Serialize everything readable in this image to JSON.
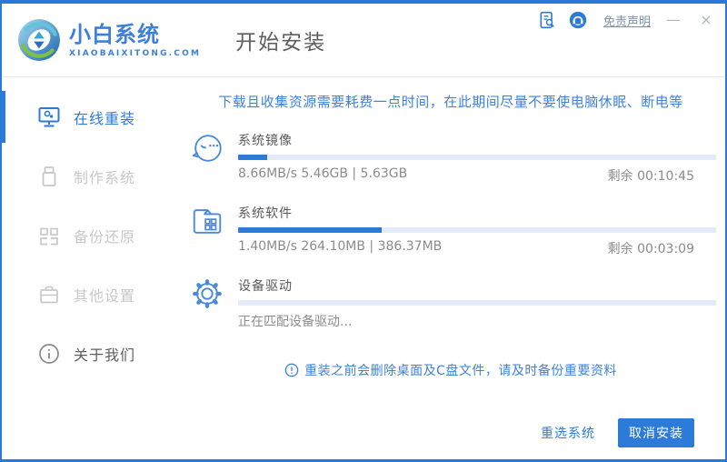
{
  "colors": {
    "accent": "#2d7bd8",
    "notice_blue": "#3e82dc",
    "track": "#e2ebf7",
    "inactive_gray": "#c8c8c8",
    "text_gray": "#5a5a5a",
    "sub_gray": "#8c8c8c"
  },
  "header": {
    "brand_name": "小白系统",
    "brand_domain": "XIAOBAIXITONG.COM",
    "page_title": "开始安装",
    "disclaimer_link": "免责声明",
    "minimize_label": "—",
    "close_label": "×",
    "icons": [
      "doc-search-icon",
      "customer-service-icon"
    ]
  },
  "sidebar": {
    "items": [
      {
        "label": "在线重装",
        "icon": "monitor-icon",
        "active": true
      },
      {
        "label": "制作系统",
        "icon": "usb-icon",
        "active": false
      },
      {
        "label": "备份还原",
        "icon": "backup-blocks-icon",
        "active": false
      },
      {
        "label": "其他设置",
        "icon": "toolbox-icon",
        "active": false
      },
      {
        "label": "关于我们",
        "icon": "info-icon",
        "active": false
      }
    ]
  },
  "main": {
    "notice": "下载且收集资源需要耗费一点时间，在此期间尽量不要使电脑休眠、断电等",
    "tasks": [
      {
        "name": "系统镜像",
        "icon": "mascot-face-icon",
        "progress_percent": 6,
        "detail": "8.66MB/s 5.46GB | 5.63GB",
        "remaining": "剩余 00:10:45"
      },
      {
        "name": "系统软件",
        "icon": "folder-apps-icon",
        "progress_percent": 30,
        "detail": "1.40MB/s 264.10MB | 386.37MB",
        "remaining": "剩余 00:03:09"
      },
      {
        "name": "设备驱动",
        "icon": "gear-icon",
        "progress_percent": 0,
        "detail": "正在匹配设备驱动...",
        "remaining": ""
      }
    ],
    "warning_note": "重装之前会删除桌面及C盘文件，请及时备份重要资料"
  },
  "footer": {
    "reselect_label": "重选系统",
    "cancel_label": "取消安装"
  }
}
